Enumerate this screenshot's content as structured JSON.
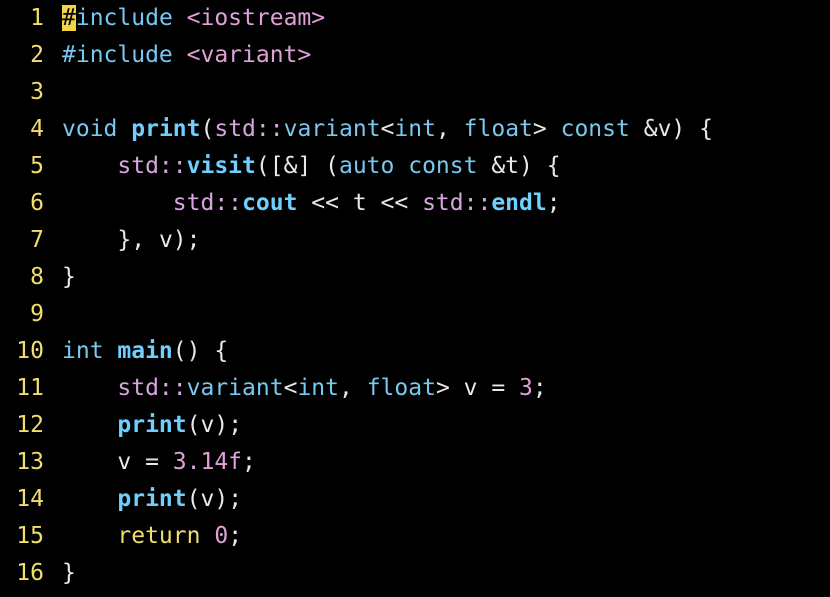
{
  "editor": {
    "lines": [
      {
        "num": "1",
        "tokens": [
          [
            "cursor",
            "#"
          ],
          [
            "pre",
            "include "
          ],
          [
            "inc",
            "<iostream>"
          ]
        ]
      },
      {
        "num": "2",
        "tokens": [
          [
            "pre",
            "#include "
          ],
          [
            "inc",
            "<variant>"
          ]
        ]
      },
      {
        "num": "3",
        "tokens": []
      },
      {
        "num": "4",
        "tokens": [
          [
            "kw",
            "void "
          ],
          [
            "fn",
            "print"
          ],
          [
            "punct",
            "("
          ],
          [
            "ns",
            "std::"
          ],
          [
            "type",
            "variant"
          ],
          [
            "punct",
            "<"
          ],
          [
            "kw",
            "int"
          ],
          [
            "punct",
            ", "
          ],
          [
            "kw",
            "float"
          ],
          [
            "punct",
            "> "
          ],
          [
            "kw",
            "const "
          ],
          [
            "punct",
            "&"
          ],
          [
            "id",
            "v"
          ],
          [
            "punct",
            ") {"
          ]
        ]
      },
      {
        "num": "5",
        "tokens": [
          [
            "punct",
            "    "
          ],
          [
            "ns",
            "std::"
          ],
          [
            "fn",
            "visit"
          ],
          [
            "punct",
            "([&] ("
          ],
          [
            "kw",
            "auto const "
          ],
          [
            "punct",
            "&"
          ],
          [
            "id",
            "t"
          ],
          [
            "punct",
            ") {"
          ]
        ]
      },
      {
        "num": "6",
        "tokens": [
          [
            "punct",
            "        "
          ],
          [
            "ns",
            "std::"
          ],
          [
            "fn",
            "cout"
          ],
          [
            "punct",
            " << "
          ],
          [
            "id",
            "t"
          ],
          [
            "punct",
            " << "
          ],
          [
            "ns",
            "std::"
          ],
          [
            "fn",
            "endl"
          ],
          [
            "punct",
            ";"
          ]
        ]
      },
      {
        "num": "7",
        "tokens": [
          [
            "punct",
            "    }, "
          ],
          [
            "id",
            "v"
          ],
          [
            "punct",
            ");"
          ]
        ]
      },
      {
        "num": "8",
        "tokens": [
          [
            "punct",
            "}"
          ]
        ]
      },
      {
        "num": "9",
        "tokens": []
      },
      {
        "num": "10",
        "tokens": [
          [
            "kw",
            "int "
          ],
          [
            "fn",
            "main"
          ],
          [
            "punct",
            "() {"
          ]
        ]
      },
      {
        "num": "11",
        "tokens": [
          [
            "punct",
            "    "
          ],
          [
            "ns",
            "std::"
          ],
          [
            "type",
            "variant"
          ],
          [
            "punct",
            "<"
          ],
          [
            "kw",
            "int"
          ],
          [
            "punct",
            ", "
          ],
          [
            "kw",
            "float"
          ],
          [
            "punct",
            "> "
          ],
          [
            "id",
            "v"
          ],
          [
            "punct",
            " = "
          ],
          [
            "num",
            "3"
          ],
          [
            "punct",
            ";"
          ]
        ]
      },
      {
        "num": "12",
        "tokens": [
          [
            "punct",
            "    "
          ],
          [
            "fn",
            "print"
          ],
          [
            "punct",
            "("
          ],
          [
            "id",
            "v"
          ],
          [
            "punct",
            ");"
          ]
        ]
      },
      {
        "num": "13",
        "tokens": [
          [
            "punct",
            "    "
          ],
          [
            "id",
            "v"
          ],
          [
            "punct",
            " = "
          ],
          [
            "num",
            "3.14f"
          ],
          [
            "punct",
            ";"
          ]
        ]
      },
      {
        "num": "14",
        "tokens": [
          [
            "punct",
            "    "
          ],
          [
            "fn",
            "print"
          ],
          [
            "punct",
            "("
          ],
          [
            "id",
            "v"
          ],
          [
            "punct",
            ");"
          ]
        ]
      },
      {
        "num": "15",
        "tokens": [
          [
            "punct",
            "    "
          ],
          [
            "ret",
            "return "
          ],
          [
            "num",
            "0"
          ],
          [
            "punct",
            ";"
          ]
        ]
      },
      {
        "num": "16",
        "tokens": [
          [
            "punct",
            "}"
          ]
        ]
      }
    ]
  },
  "colors": {
    "background": "#000000",
    "line_number": "#f2df6b",
    "cursor": "#f0d645",
    "keyword": "#79c9ee",
    "function": "#6fd0ff",
    "namespace": "#d7a6e0",
    "literal": "#e0a0d8",
    "text": "#e8e8e8"
  }
}
